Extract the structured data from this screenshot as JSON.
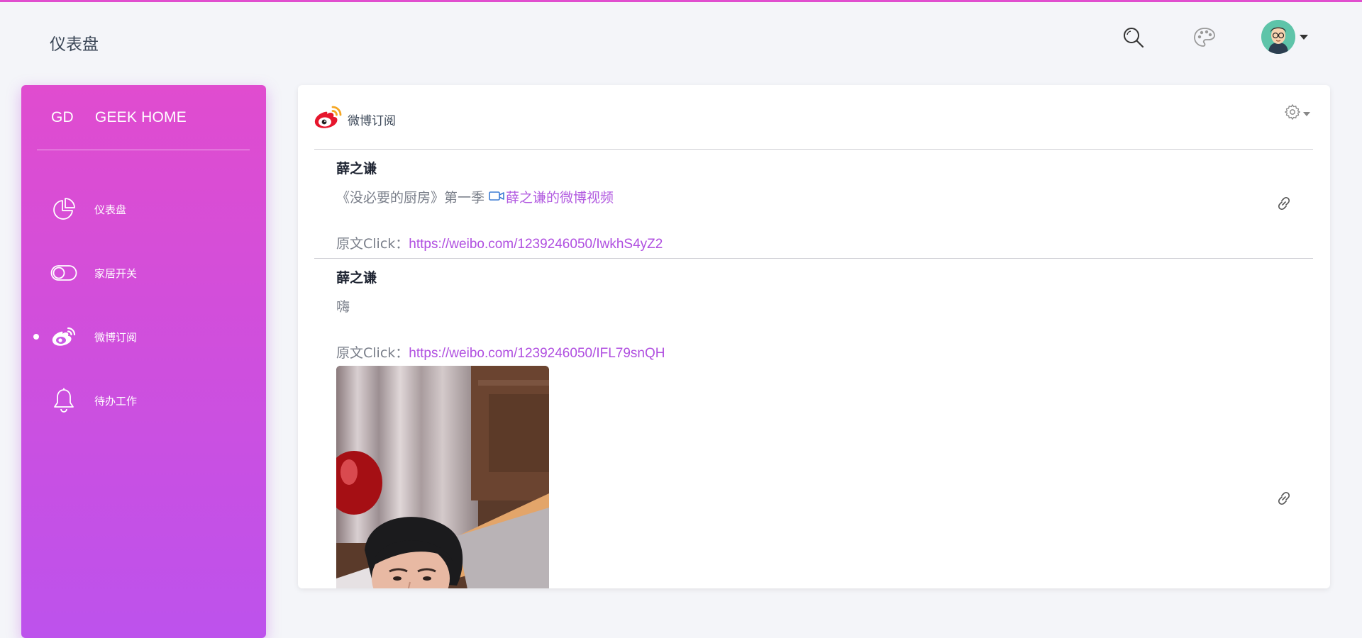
{
  "header": {
    "title": "仪表盘",
    "icons": [
      "search-icon",
      "palette-icon",
      "avatar",
      "chevron-down-icon"
    ]
  },
  "sidebar": {
    "brand_short": "GD",
    "brand_name": "GEEK HOME",
    "items": [
      {
        "label": "仪表盘",
        "icon": "pie-chart-icon",
        "active": false
      },
      {
        "label": "家居开关",
        "icon": "toggle-icon",
        "active": false
      },
      {
        "label": "微博订阅",
        "icon": "weibo-icon",
        "active": true
      },
      {
        "label": "待办工作",
        "icon": "bell-icon",
        "active": false
      }
    ]
  },
  "card": {
    "title": "微博订阅",
    "icon": "weibo-logo-icon",
    "settings_icon": "gear-icon",
    "posts": [
      {
        "author": "薛之谦",
        "text": "《没必要的厨房》第一季",
        "video_link_text": "薛之谦的微博视频",
        "source_label": "原文Click：",
        "source_url": "https://weibo.com/1239246050/IwkhS4yZ2"
      },
      {
        "author": "薛之谦",
        "text": "嗨",
        "source_label": "原文Click：",
        "source_url": "https://weibo.com/1239246050/IFL79snQH",
        "image": "selfie-photo"
      }
    ]
  },
  "colors": {
    "accent": "#e14ecf",
    "sidebar_top": "#e04ccf",
    "sidebar_bottom": "#bd52ec",
    "link": "#b04fe0"
  }
}
